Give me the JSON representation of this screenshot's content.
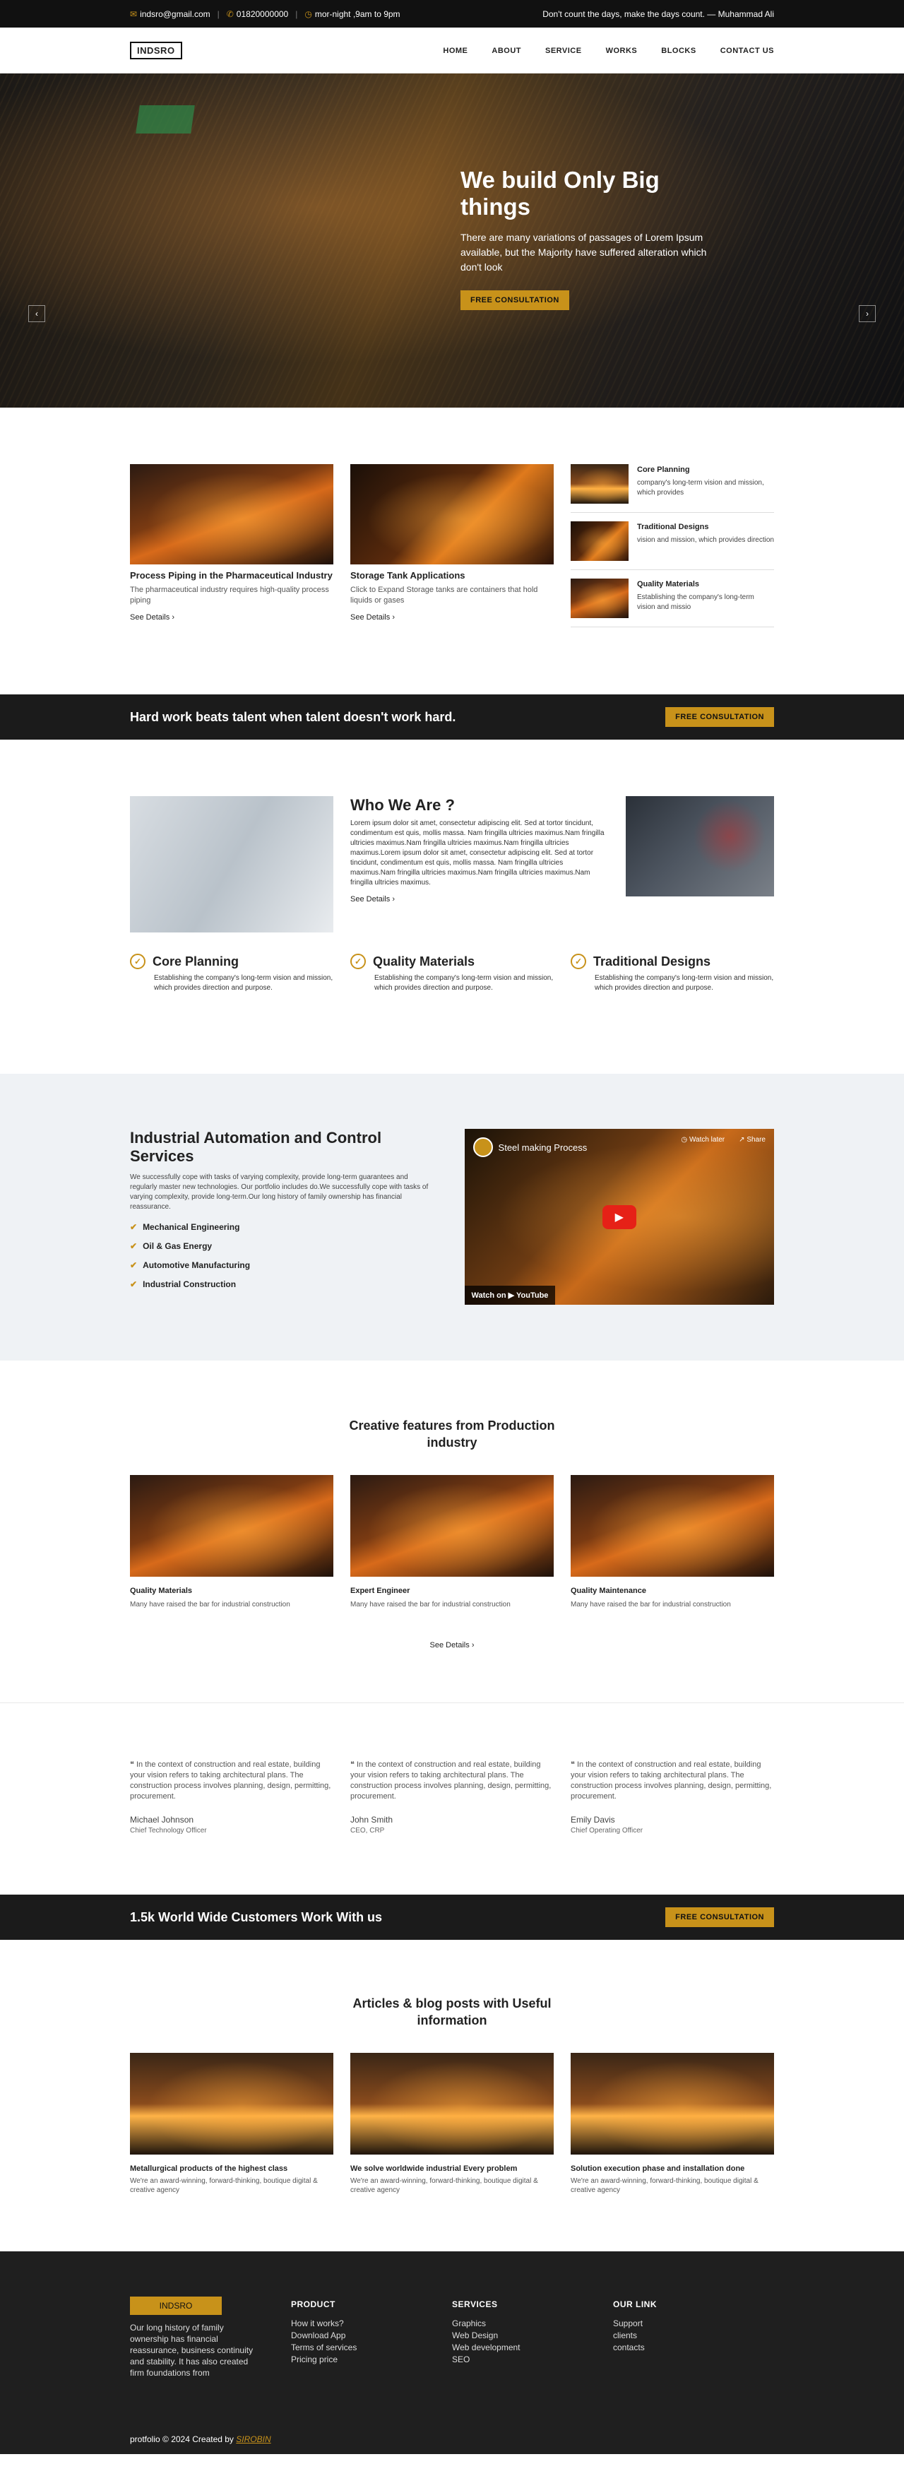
{
  "topbar": {
    "email": "indsro@gmail.com",
    "phone": "01820000000",
    "hours": "mor-night ,9am to 9pm",
    "quote": "Don't count the days, make the days count. — Muhammad Ali"
  },
  "nav": {
    "logo": "INDSRO",
    "items": [
      "HOME",
      "ABOUT",
      "SERVICE",
      "WORKS",
      "BLOCKS",
      "CONTACT US"
    ]
  },
  "hero": {
    "title": "We build Only Big things",
    "text": "There are many variations of passages of Lorem Ipsum available, but the Majority have suffered alteration which don't look",
    "button": "FREE CONSULTATION"
  },
  "services": {
    "cards": [
      {
        "title": "Process Piping in the Pharmaceutical Industry",
        "text": "The pharmaceutical industry requires high-quality process piping",
        "link": "See Details"
      },
      {
        "title": "Storage Tank Applications",
        "text": "Click to Expand Storage tanks are containers that hold liquids or gases",
        "link": "See Details"
      }
    ],
    "side": [
      {
        "title": "Core Planning",
        "text": "company's long-term vision and mission, which provides"
      },
      {
        "title": "Traditional Designs",
        "text": "vision and mission, which provides direction"
      },
      {
        "title": "Quality Materials",
        "text": "Establishing the company's long-term vision and missio"
      }
    ]
  },
  "banner1": {
    "text": "Hard work beats talent when talent doesn't work hard.",
    "button": "FREE CONSULTATION"
  },
  "who": {
    "title": "Who We Are ?",
    "text": "Lorem ipsum dolor sit amet, consectetur adipiscing elit. Sed at tortor tincidunt, condimentum est quis, mollis massa. Nam fringilla ultricies maximus.Nam fringilla ultricies maximus.Nam fringilla ultricies maximus.Nam fringilla ultricies maximus.Lorem ipsum dolor sit amet, consectetur adipiscing elit. Sed at tortor tincidunt, condimentum est quis, mollis massa. Nam fringilla ultricies maximus.Nam fringilla ultricies maximus.Nam fringilla ultricies maximus.Nam fringilla ultricies maximus.",
    "link": "See Details",
    "features": [
      {
        "title": "Core Planning",
        "text": "Establishing the company's long-term vision and mission, which provides direction and purpose."
      },
      {
        "title": "Quality Materials",
        "text": "Establishing the company's long-term vision and mission, which provides direction and purpose."
      },
      {
        "title": "Traditional Designs",
        "text": "Establishing the company's long-term vision and mission, which provides direction and purpose."
      }
    ]
  },
  "industrial": {
    "title": "Industrial Automation and Control Services",
    "text": "We successfully cope with tasks of varying complexity, provide long-term guarantees and regularly master new technologies. Our portfolio includes do.We successfully cope with tasks of varying complexity, provide long-term.Our long history of family ownership has financial reassurance.",
    "list": [
      "Mechanical Engineering",
      "Oil & Gas Energy",
      "Automotive Manufacturing",
      "Industrial Construction"
    ],
    "video": {
      "title": "Steel making Process",
      "watch_later": "Watch later",
      "share": "Share",
      "watch_on": "Watch on",
      "youtube": "YouTube"
    }
  },
  "creative": {
    "title": "Creative features from Production industry",
    "cards": [
      {
        "title": "Quality Materials",
        "text": "Many have raised the bar for industrial construction"
      },
      {
        "title": "Expert Engineer",
        "text": "Many have raised the bar for industrial construction"
      },
      {
        "title": "Quality Maintenance",
        "text": "Many have raised the bar for industrial construction"
      }
    ],
    "link": "See Details"
  },
  "testimonials": [
    {
      "quote": "In the context of construction and real estate, building your vision refers to taking architectural plans. The construction process involves planning, design, permitting, procurement.",
      "name": "Michael Johnson",
      "role": "Chief Technology Officer"
    },
    {
      "quote": "In the context of construction and real estate, building your vision refers to taking architectural plans. The construction process involves planning, design, permitting, procurement.",
      "name": "John Smith",
      "role": "CEO, CRP"
    },
    {
      "quote": "In the context of construction and real estate, building your vision refers to taking architectural plans. The construction process involves planning, design, permitting, procurement.",
      "name": "Emily Davis",
      "role": "Chief Operating Officer"
    }
  ],
  "banner2": {
    "text": "1.5k World Wide Customers Work With us",
    "button": "FREE CONSULTATION"
  },
  "blog": {
    "title": "Articles & blog posts with Useful information",
    "cards": [
      {
        "title": "Metallurgical products of the highest class",
        "text": "We're an award-winning, forward-thinking, boutique digital & creative agency"
      },
      {
        "title": "We solve worldwide industrial Every problem",
        "text": "We're an award-winning, forward-thinking, boutique digital & creative agency"
      },
      {
        "title": "Solution execution phase and installation done",
        "text": "We're an award-winning, forward-thinking, boutique digital & creative agency"
      }
    ]
  },
  "footer": {
    "logo": "INDSRO",
    "desc": "Our long history of family ownership has financial reassurance, business continuity and stability. It has also created firm foundations from",
    "product": {
      "title": "PRODUCT",
      "items": [
        "How it works?",
        "Download App",
        "Terms of services",
        "Pricing price"
      ]
    },
    "services": {
      "title": "SERVICES",
      "items": [
        "Graphics",
        "Web Design",
        "Web development",
        "SEO"
      ]
    },
    "links": {
      "title": "OUR LINK",
      "items": [
        "Support",
        "clients",
        "contacts"
      ]
    },
    "copy": "protfolio © 2024 Created by",
    "author": "SIROBIN"
  },
  "colors": {
    "accent": "#c8921a",
    "dark": "#1b1b1b",
    "light_bg": "#eff2f5"
  }
}
